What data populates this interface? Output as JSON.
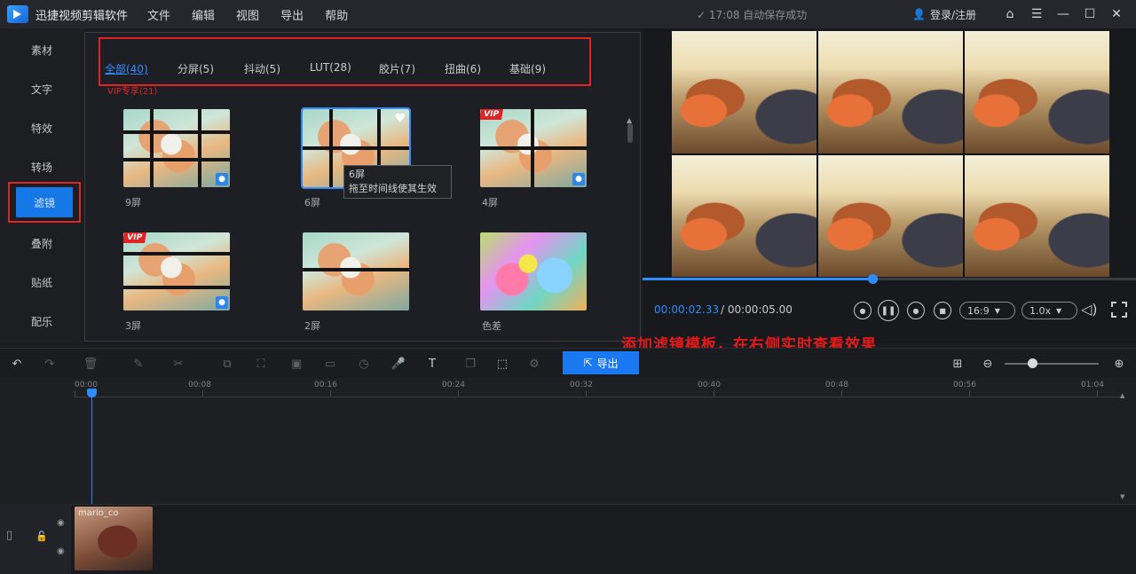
{
  "app": {
    "title": "迅捷视频剪辑软件",
    "menu": [
      "文件",
      "编辑",
      "视图",
      "导出",
      "帮助"
    ],
    "save_status": "17:08 自动保存成功",
    "login": "登录/注册"
  },
  "sidebar": {
    "items": [
      "素材",
      "文字",
      "特效",
      "转场",
      "滤镜",
      "叠附",
      "贴纸",
      "配乐"
    ],
    "active": "滤镜"
  },
  "panel": {
    "tabs": [
      "全部(40)",
      "分屏(5)",
      "抖动(5)",
      "LUT(28)",
      "胶片(7)",
      "扭曲(6)",
      "基础(9)"
    ],
    "active_tab": "全部(40)",
    "vip_count": "VIP专享(21)",
    "cards": [
      {
        "label": "9屏",
        "vip": false,
        "user_badge": true,
        "selected": false
      },
      {
        "label": "6屏",
        "vip": false,
        "user_badge": false,
        "selected": true,
        "favorite": true
      },
      {
        "label": "4屏",
        "vip": true,
        "user_badge": true,
        "selected": false
      },
      {
        "label": "3屏",
        "vip": true,
        "user_badge": true,
        "selected": false
      },
      {
        "label": "2屏",
        "vip": false,
        "user_badge": false,
        "selected": false
      },
      {
        "label": "色差",
        "vip": false,
        "user_badge": false,
        "selected": false
      }
    ],
    "vip_badge_text": "VIP",
    "tooltip": {
      "title": "6屏",
      "hint": "拖至时间线使其生效"
    }
  },
  "preview": {
    "current_time": "00:00:02.33",
    "total_time": "/ 00:00:05.00",
    "progress": 0.466,
    "aspect": "16:9",
    "speed": "1.0x"
  },
  "annotation": "添加滤镜模板，在右侧实时查看效果",
  "toolbar": {
    "export_label": "导出",
    "zoom": 0.25
  },
  "timeline": {
    "ruler": [
      "00:00",
      "00:08",
      "00:16",
      "00:24",
      "00:32",
      "00:40",
      "00:48",
      "00:56",
      "01:04"
    ],
    "clip_name": "mario_co"
  },
  "colors": {
    "accent": "#1a79f0",
    "annotation_red": "#e31b1b",
    "background": "#1b1c20"
  }
}
